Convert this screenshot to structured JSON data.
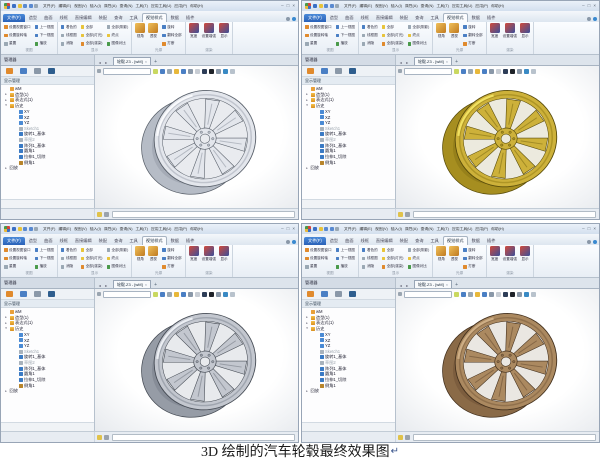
{
  "caption": {
    "text": "3D 绘制的汽车轮毂最终效果图",
    "mark": "↵"
  },
  "chrome": {
    "qa_icons": [
      {
        "n": "save-icon",
        "c": "#3a6fc4"
      },
      {
        "n": "open-icon",
        "c": "#e8c43a"
      },
      {
        "n": "undo-icon",
        "c": "#5a8ad0"
      },
      {
        "n": "redo-icon",
        "c": "#5a8ad0"
      },
      {
        "n": "print-icon",
        "c": "#9aa8b4"
      }
    ],
    "menus": [
      {
        "t": "文件(F)"
      },
      {
        "t": "编辑(E)"
      },
      {
        "t": "视图(V)"
      },
      {
        "t": "插入(I)"
      },
      {
        "t": "属性(A)"
      },
      {
        "t": "查询(N)"
      },
      {
        "t": "工具(T)"
      },
      {
        "t": "应用工具(U)"
      },
      {
        "t": "应用(P)"
      },
      {
        "t": "帮助(H)"
      }
    ],
    "winctl": [
      "–",
      "□",
      "×"
    ],
    "file_tab": "文件(F)",
    "tabs": [
      {
        "t": "造型",
        "cls": ""
      },
      {
        "t": "曲面",
        "cls": ""
      },
      {
        "t": "线框",
        "cls": ""
      },
      {
        "t": "直接编辑",
        "cls": ""
      },
      {
        "t": "装配",
        "cls": ""
      },
      {
        "t": "查询",
        "cls": ""
      },
      {
        "t": "工具",
        "cls": ""
      },
      {
        "t": "视觉样式",
        "cls": "active"
      },
      {
        "t": "数据",
        "cls": ""
      },
      {
        "t": "插件",
        "cls": ""
      }
    ],
    "tabbar_right": [
      {
        "n": "minimize-ribbon-icon",
        "c": "#8a98a8"
      },
      {
        "n": "help-icon",
        "c": "#3a8ad0"
      }
    ],
    "ribbon": {
      "groups": [
        {
          "label": "视图"
        },
        {
          "label": "显示"
        },
        {
          "label": "光源"
        },
        {
          "label": "渲染"
        }
      ],
      "g1c1": [
        {
          "t": "设置视图窗口",
          "c": "#e08a2d"
        },
        {
          "t": "设置旋转轴",
          "c": "#e08a2d"
        },
        {
          "t": "重置",
          "c": "#9aa8b4"
        }
      ],
      "g1c2": [
        {
          "t": "上一视图",
          "c": "#4a7fc4"
        },
        {
          "t": "下一视图",
          "c": "#4a7fc4"
        },
        {
          "t": "播放",
          "c": "#4a9a4a"
        }
      ],
      "g2c1": [
        {
          "t": "着色的",
          "c": "#4a7fc4"
        },
        {
          "t": "线框图",
          "c": "#9aa8b4"
        },
        {
          "t": "消隐",
          "c": "#9aa8b4"
        }
      ],
      "g2c2": [
        {
          "t": "全部",
          "c": "#e8c43a"
        },
        {
          "t": "全部(灯光)",
          "c": "#e8c43a"
        },
        {
          "t": "全部(渲染)",
          "c": "#e08a2d"
        }
      ],
      "g2c3": [
        {
          "t": "全部(阴影)",
          "c": "#9aa8b4"
        },
        {
          "t": "终点",
          "c": "#e8c43a"
        },
        {
          "t": "图像对比",
          "c": "#4a9a4a"
        }
      ],
      "g3big": [
        {
          "n": "view-angle-icon",
          "t": "视角",
          "g": "linear-gradient(135deg,#f0c05a,#c07a20)"
        },
        {
          "n": "perspective-icon",
          "t": "透视",
          "g": "linear-gradient(135deg,#f0c05a,#c07a20)"
        }
      ],
      "g3c1": [
        {
          "t": "旋转",
          "c": "#4a7fc4"
        },
        {
          "t": "翻转全部",
          "c": "#4a7fc4"
        },
        {
          "t": "打断",
          "c": "#e08a2d"
        }
      ],
      "g4big": [
        {
          "n": "width-icon",
          "t": "宽度",
          "g": "linear-gradient(135deg,#d24a3a,#3a4f9a)"
        },
        {
          "n": "enhance-icon",
          "t": "设置增强",
          "g": "linear-gradient(135deg,#d24a3a,#3a4f9a)"
        },
        {
          "n": "display-icon",
          "t": "显示",
          "g": "linear-gradient(135deg,#d24a3a,#3a4f9a)"
        }
      ]
    },
    "doc": {
      "back": "◄",
      "fwd": "►",
      "tab": "轮毂.Z3 - [wM]",
      "close": "×",
      "newtab": "+"
    },
    "manager": {
      "title": "管理器",
      "tabs": [
        {
          "n": "history-manager-tab-icon",
          "c": "#e08a2d"
        },
        {
          "n": "assembly-manager-tab-icon",
          "c": "#4a7fc4"
        },
        {
          "n": "visual-manager-tab-icon",
          "c": "#8a98a8"
        },
        {
          "n": "layer-manager-tab-icon",
          "c": "#2e5e8e"
        }
      ],
      "section": "显示管理",
      "tree": [
        {
          "tw": "",
          "t": "wM",
          "cls": "i-part",
          "rcls": "",
          "p": "3px"
        },
        {
          "tw": "▸",
          "t": "造型(1)",
          "cls": "i-folder",
          "rcls": "",
          "p": "3px"
        },
        {
          "tw": "▸",
          "t": "表达式(1)",
          "cls": "i-folder",
          "rcls": "",
          "p": "3px"
        },
        {
          "tw": "▾",
          "t": "历史",
          "cls": "i-folder",
          "rcls": "",
          "p": "3px"
        },
        {
          "tw": "",
          "t": "XY",
          "cls": "i-plane",
          "rcls": "",
          "p": "12px"
        },
        {
          "tw": "",
          "t": "XZ",
          "cls": "i-plane",
          "rcls": "",
          "p": "12px"
        },
        {
          "tw": "",
          "t": "YZ",
          "cls": "i-plane",
          "rcls": "",
          "p": "12px"
        },
        {
          "tw": "",
          "t": "Sketch1",
          "cls": "i-sketch",
          "rcls": "dim",
          "p": "12px"
        },
        {
          "tw": "",
          "t": "旋转1_基体",
          "cls": "i-feat",
          "rcls": "",
          "p": "12px"
        },
        {
          "tw": "",
          "t": "草图2",
          "cls": "i-sketch",
          "rcls": "dim",
          "p": "12px"
        },
        {
          "tw": "",
          "t": "阵列1_基体",
          "cls": "i-feat",
          "rcls": "",
          "p": "12px"
        },
        {
          "tw": "",
          "t": "圆角1",
          "cls": "i-feat",
          "rcls": "",
          "p": "12px"
        },
        {
          "tw": "",
          "t": "拉伸1_切除",
          "cls": "i-feat",
          "rcls": "",
          "p": "12px"
        },
        {
          "tw": "",
          "t": "倒角1",
          "cls": "i-pencil",
          "rcls": "",
          "p": "12px"
        }
      ],
      "replay": "回放"
    },
    "viewport_icons": [
      {
        "n": "shade-mode-icon",
        "c": "#c9d860"
      },
      {
        "n": "view-orient-icon",
        "c": "#4a7fc4"
      },
      {
        "n": "zoom-icon",
        "c": "#9aa8b4"
      },
      {
        "n": "light-icon",
        "c": "#e8b83a"
      },
      {
        "n": "render-mode-icon",
        "c": "#4a7fc4"
      },
      {
        "n": "section-icon",
        "c": "#8a98a8"
      },
      {
        "n": "sketch-pencil-icon",
        "c": "#c8cdd4"
      },
      {
        "n": "background-dark-icon",
        "c": "#2e3e58"
      },
      {
        "n": "background-black-icon",
        "c": "#1e2228"
      },
      {
        "n": "grid-icon",
        "c": "#8a98a8"
      },
      {
        "n": "globe-icon",
        "c": "#3a8ac4"
      },
      {
        "n": "settings-icon",
        "c": "#b8c2cc"
      }
    ],
    "status_icons": [
      {
        "n": "filter-icon",
        "c": "#e0c24a"
      },
      {
        "n": "selection-filter-icon",
        "c": "#9aa2ac"
      }
    ]
  },
  "windows": [
    {
      "name": "cad-window-silver-wheel",
      "wheel": {
        "face": "#e3e6ec",
        "mid": "#b6bcc6",
        "dark": "#868d99",
        "line": "#5b626c",
        "open": "#e9ebef",
        "hi": "#fbfcfe"
      }
    },
    {
      "name": "cad-window-gold-wheel",
      "wheel": {
        "face": "#cdb13a",
        "mid": "#a68e20",
        "dark": "#776610",
        "line": "#5a4d0b",
        "open": "#eceade",
        "hi": "#f4e565"
      }
    },
    {
      "name": "cad-window-steel-wheel",
      "wheel": {
        "face": "#c3c7cf",
        "mid": "#969ca6",
        "dark": "#6b717b",
        "line": "#474d56",
        "open": "#e8eaed",
        "hi": "#f0f2f6"
      }
    },
    {
      "name": "cad-window-bronze-wheel",
      "wheel": {
        "face": "#ab8960",
        "mid": "#8a6a47",
        "dark": "#60462d",
        "line": "#44311e",
        "open": "#eae7e2",
        "hi": "#d2b28a"
      }
    }
  ]
}
